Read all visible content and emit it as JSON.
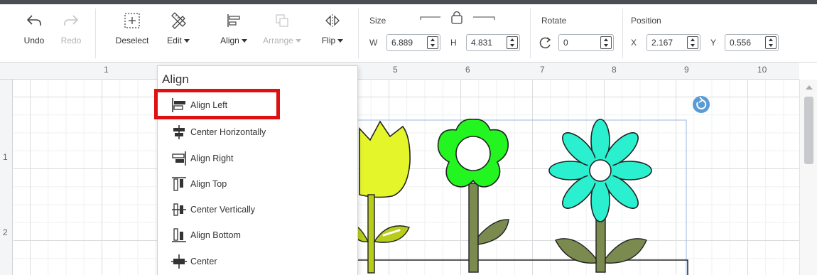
{
  "toolbar": {
    "undo_label": "Undo",
    "redo_label": "Redo",
    "deselect_label": "Deselect",
    "edit_label": "Edit",
    "align_label": "Align",
    "arrange_label": "Arrange",
    "flip_label": "Flip",
    "size": {
      "label": "Size",
      "w_label": "W",
      "w_value": "6.889",
      "h_label": "H",
      "h_value": "4.831"
    },
    "rotate": {
      "label": "Rotate",
      "value": "0"
    },
    "position": {
      "label": "Position",
      "x_label": "X",
      "x_value": "2.167",
      "y_label": "Y",
      "y_value": "0.556"
    }
  },
  "ruler": {
    "top": [
      "1",
      "5",
      "6",
      "7",
      "8",
      "9",
      "10"
    ],
    "left": [
      "1",
      "2"
    ]
  },
  "align_menu": {
    "title": "Align",
    "items": [
      {
        "label": "Align Left",
        "icon": "align-left-icon"
      },
      {
        "label": "Center Horizontally",
        "icon": "center-horizontally-icon"
      },
      {
        "label": "Align Right",
        "icon": "align-right-icon"
      },
      {
        "label": "Align Top",
        "icon": "align-top-icon"
      },
      {
        "label": "Center Vertically",
        "icon": "center-vertically-icon"
      },
      {
        "label": "Align Bottom",
        "icon": "align-bottom-icon"
      },
      {
        "label": "Center",
        "icon": "center-icon"
      }
    ],
    "highlighted_item": "Align Left"
  },
  "colors": {
    "tulip": "#e4f52a",
    "green_flower": "#22f51f",
    "teal_flower": "#2af0d0",
    "stem": "#7b8a4e",
    "highlight": "#e01010",
    "rotate_handle": "#5b9bd5"
  }
}
